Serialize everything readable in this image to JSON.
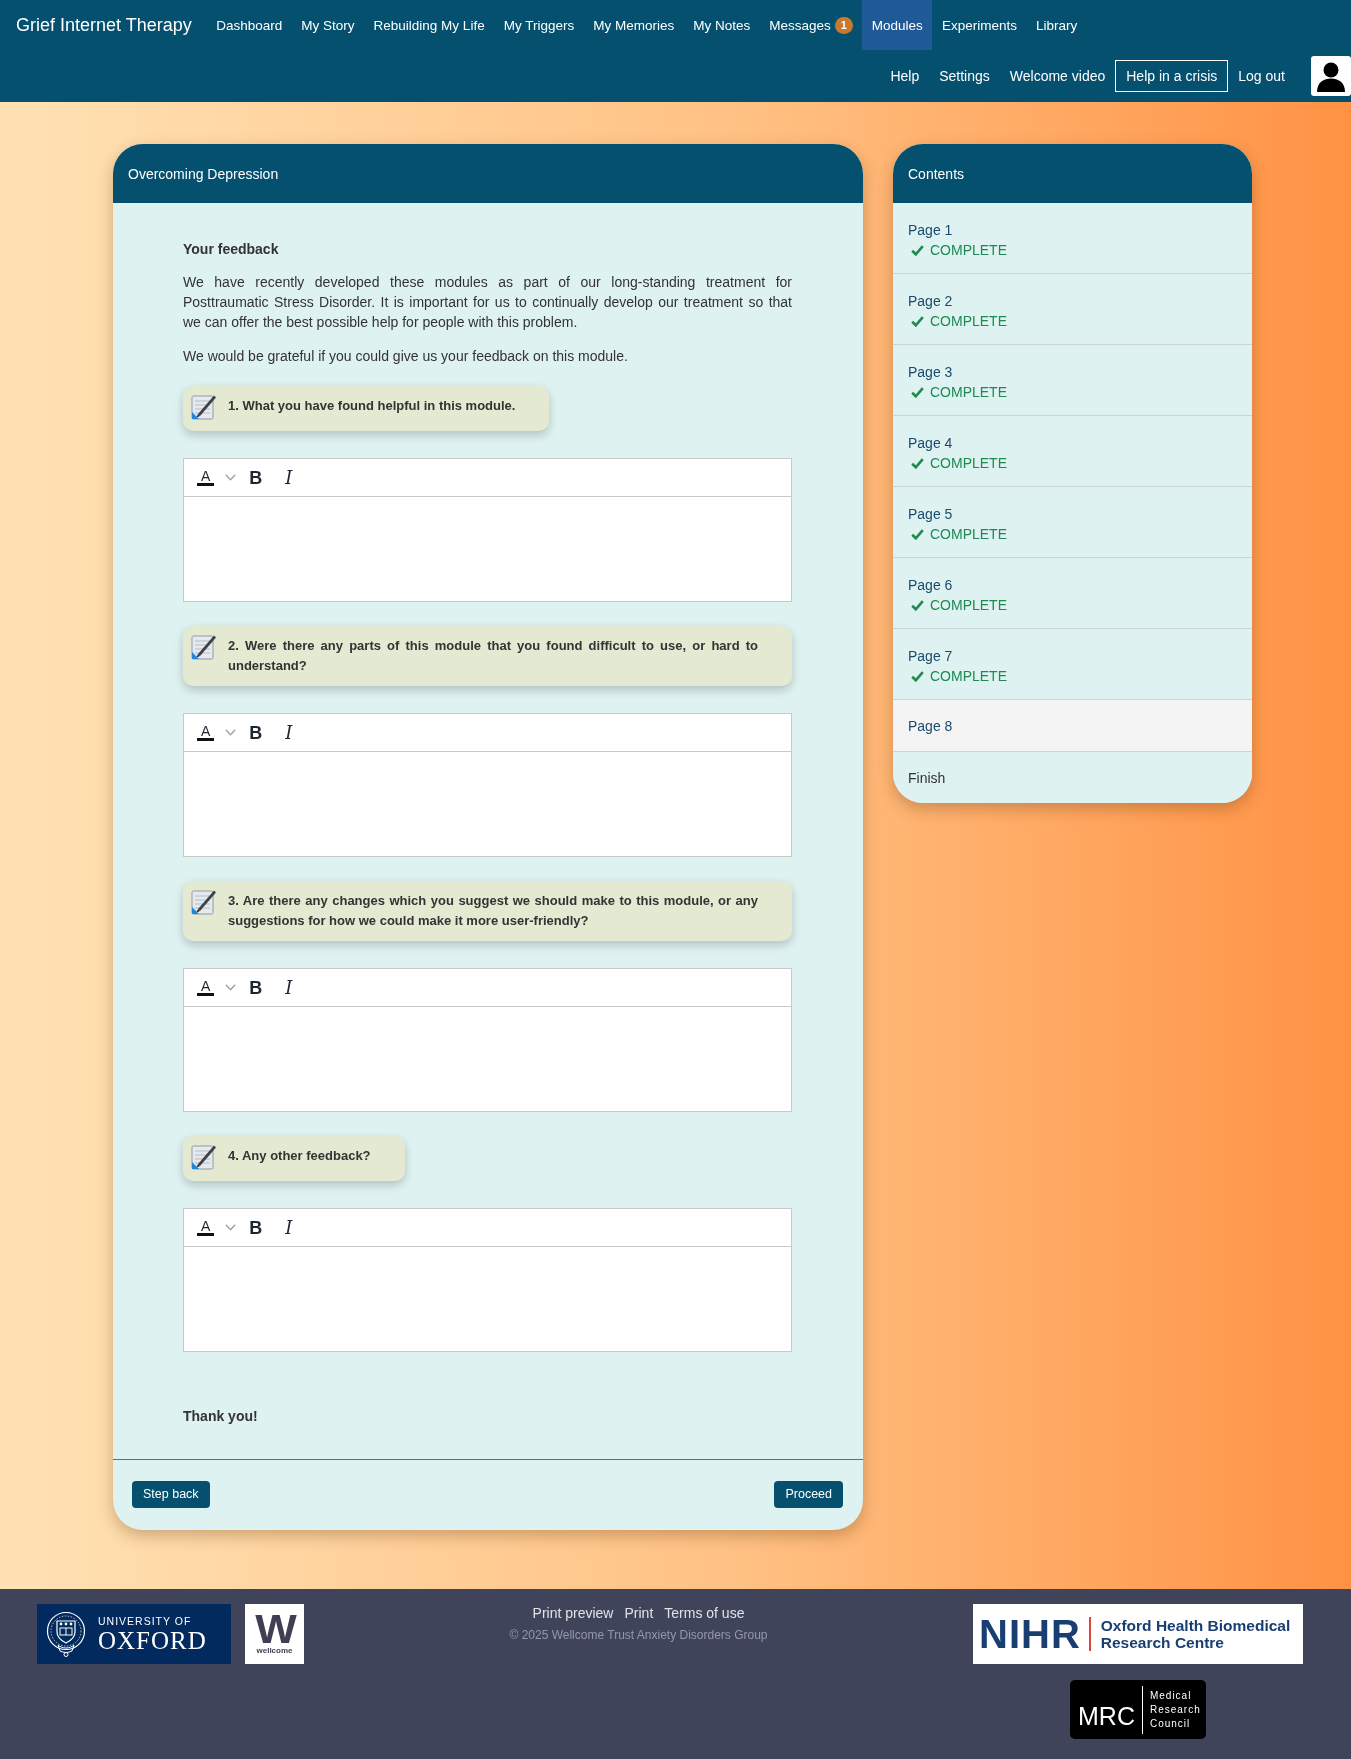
{
  "header": {
    "title": "Grief Internet Therapy",
    "nav": [
      {
        "label": "Dashboard",
        "selected": false
      },
      {
        "label": "My Story",
        "selected": false
      },
      {
        "label": "Rebuilding My Life",
        "selected": false
      },
      {
        "label": "My Triggers",
        "selected": false
      },
      {
        "label": "My Memories",
        "selected": false
      },
      {
        "label": "My Notes",
        "selected": false
      },
      {
        "label": "Messages",
        "badge": "1",
        "selected": false
      },
      {
        "label": "Modules",
        "selected": true
      },
      {
        "label": "Experiments",
        "selected": false
      },
      {
        "label": "Library",
        "selected": false
      }
    ],
    "secondary_nav": [
      {
        "label": "Help",
        "kind": "link"
      },
      {
        "label": "Settings",
        "kind": "link"
      },
      {
        "label": "Welcome video",
        "kind": "link"
      },
      {
        "label": "Help in a crisis",
        "kind": "outlined"
      },
      {
        "label": "Log out",
        "kind": "link"
      }
    ]
  },
  "module": {
    "title": "Overcoming Depression",
    "heading": "Your feedback",
    "paragraphs": [
      "We have recently developed these modules as part of our long-standing treatment for Posttraumatic Stress Disorder. It is important for us to continually develop our treatment so that we can offer the best possible help for people with this problem.",
      "We would be grateful if you could give us your feedback on this module."
    ],
    "questions": [
      {
        "text": "1. What you have found helpful in this module.",
        "toolbar": [
          {
            "kind": "color",
            "label": "A"
          },
          {
            "kind": "bold",
            "label": "B"
          },
          {
            "kind": "italic",
            "label": "I"
          }
        ]
      },
      {
        "text": "2. Were there any parts of this module that you found difficult to use, or hard to understand?",
        "toolbar": [
          {
            "kind": "color",
            "label": "A"
          },
          {
            "kind": "bold",
            "label": "B"
          },
          {
            "kind": "italic",
            "label": "I"
          }
        ]
      },
      {
        "text": "3. Are there any changes which you suggest we should make to this module, or any suggestions for how we could make it more user-friendly?",
        "toolbar": [
          {
            "kind": "color",
            "label": "A"
          },
          {
            "kind": "bold",
            "label": "B"
          },
          {
            "kind": "italic",
            "label": "I"
          }
        ]
      },
      {
        "text": "4. Any other feedback?",
        "toolbar": [
          {
            "kind": "color",
            "label": "A"
          },
          {
            "kind": "bold",
            "label": "B"
          },
          {
            "kind": "italic",
            "label": "I"
          }
        ]
      }
    ],
    "closing": "Thank you!",
    "buttons": [
      "Step back",
      "Proceed"
    ]
  },
  "contents": {
    "title": "Contents",
    "items": [
      {
        "label": "Page 1",
        "complete": true,
        "status": "COMPLETE",
        "selected": false,
        "disabled": false
      },
      {
        "label": "Page 2",
        "complete": true,
        "status": "COMPLETE",
        "selected": false,
        "disabled": false
      },
      {
        "label": "Page 3",
        "complete": true,
        "status": "COMPLETE",
        "selected": false,
        "disabled": false
      },
      {
        "label": "Page 4",
        "complete": true,
        "status": "COMPLETE",
        "selected": false,
        "disabled": false
      },
      {
        "label": "Page 5",
        "complete": true,
        "status": "COMPLETE",
        "selected": false,
        "disabled": false
      },
      {
        "label": "Page 6",
        "complete": true,
        "status": "COMPLETE",
        "selected": false,
        "disabled": false
      },
      {
        "label": "Page 7",
        "complete": true,
        "status": "COMPLETE",
        "selected": false,
        "disabled": false
      },
      {
        "label": "Page 8",
        "complete": false,
        "selected": true,
        "disabled": false
      },
      {
        "label": "Finish",
        "complete": false,
        "selected": false,
        "disabled": true
      }
    ]
  },
  "footer": {
    "logos_left": [
      {
        "kind": "oxford",
        "lines": [
          "UNIVERSITY OF",
          "OXFORD"
        ]
      },
      {
        "kind": "wellcome",
        "mark": "W",
        "lines": [
          "wellcome"
        ]
      }
    ],
    "links": [
      "Print preview",
      "Print",
      "Terms of use"
    ],
    "copyright": "© 2025 Wellcome Trust Anxiety Disorders Group",
    "logos_right": [
      {
        "kind": "nihr",
        "mark": "NIHR",
        "lines": [
          "Oxford Health Biomedical",
          "Research Centre"
        ]
      },
      {
        "kind": "mrc",
        "mark": "MRC",
        "lines": [
          "Medical",
          "Research",
          "Council"
        ]
      }
    ]
  }
}
